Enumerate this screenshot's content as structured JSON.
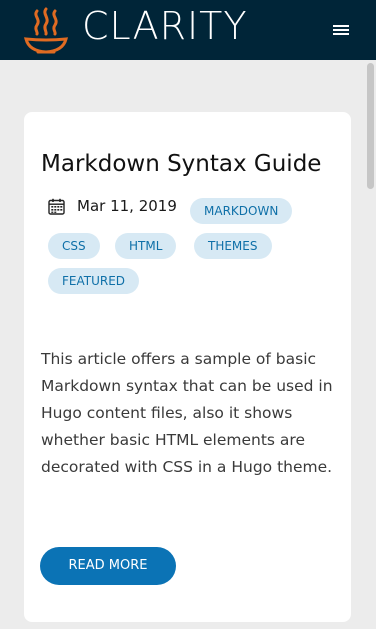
{
  "header": {
    "brand": "CLARITY",
    "logo_icon": "steaming-bowl-icon",
    "menu_icon": "hamburger-menu-icon",
    "background_color": "#002538",
    "logo_color": "#e06b22"
  },
  "post": {
    "title": "Markdown Syntax Guide",
    "date_icon": "calendar-icon",
    "date": "Mar 11, 2019",
    "tags": [
      "MARKDOWN",
      "CSS",
      "HTML",
      "THEMES",
      "FEATURED"
    ],
    "excerpt": "This article offers a sample of basic Markdown syntax that can be used in Hugo content files, also it shows whether basic HTML elements are decorated with CSS in a Hugo theme.",
    "read_more_label": "READ MORE"
  },
  "colors": {
    "tag_background": "#d7e9f4",
    "tag_text": "#0f70a8",
    "button": "#0b73b5",
    "page_background": "#ececec"
  }
}
